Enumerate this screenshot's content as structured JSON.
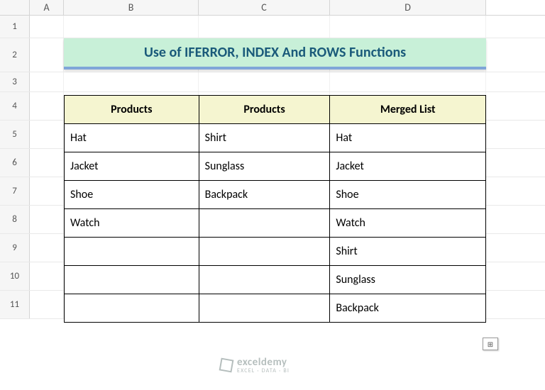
{
  "columns": [
    "A",
    "B",
    "C",
    "D"
  ],
  "rows": [
    "1",
    "2",
    "3",
    "4",
    "5",
    "6",
    "7",
    "8",
    "9",
    "10",
    "11"
  ],
  "title": "Use of IFERROR, INDEX And ROWS Functions",
  "headers": {
    "b": "Products",
    "c": "Products",
    "d": "Merged List"
  },
  "data": [
    {
      "b": "Hat",
      "c": "Shirt",
      "d": "Hat"
    },
    {
      "b": "Jacket",
      "c": "Sunglass",
      "d": "Jacket"
    },
    {
      "b": "Shoe",
      "c": "Backpack",
      "d": "Shoe"
    },
    {
      "b": "Watch",
      "c": "",
      "d": "Watch"
    },
    {
      "b": "",
      "c": "",
      "d": "Shirt"
    },
    {
      "b": "",
      "c": "",
      "d": "Sunglass"
    },
    {
      "b": "",
      "c": "",
      "d": "Backpack"
    }
  ],
  "chart_data": {
    "type": "table",
    "title": "Use of IFERROR, INDEX And ROWS Functions",
    "columns": [
      "Products",
      "Products",
      "Merged List"
    ],
    "rows": [
      [
        "Hat",
        "Shirt",
        "Hat"
      ],
      [
        "Jacket",
        "Sunglass",
        "Jacket"
      ],
      [
        "Shoe",
        "Backpack",
        "Shoe"
      ],
      [
        "Watch",
        "",
        "Watch"
      ],
      [
        "",
        "",
        "Shirt"
      ],
      [
        "",
        "",
        "Sunglass"
      ],
      [
        "",
        "",
        "Backpack"
      ]
    ]
  },
  "watermark": {
    "brand": "exceldemy",
    "tag": "EXCEL · DATA · BI"
  },
  "autofill_glyph": "⊞"
}
